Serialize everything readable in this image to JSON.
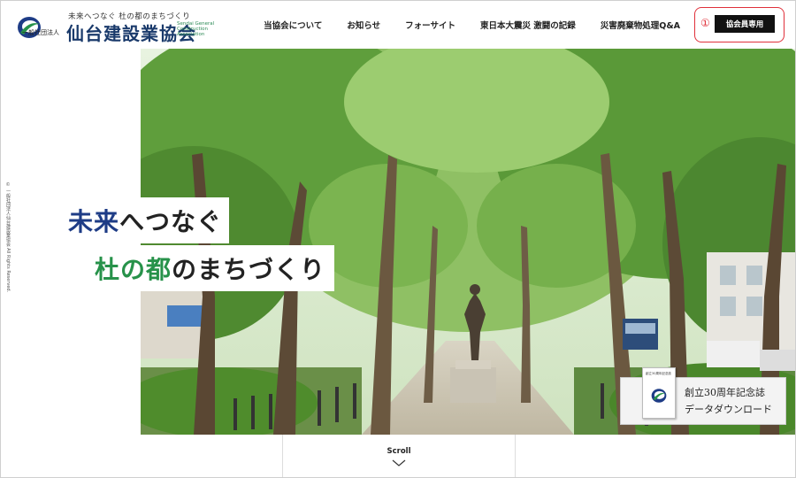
{
  "header": {
    "logo": {
      "tagline": "未来へつなぐ 杜の都のまちづくり",
      "org_type": "一般社団法人",
      "name": "仙台建設業協会",
      "english": "Sendai General Construction Association"
    },
    "nav": [
      {
        "label": "当協会について"
      },
      {
        "label": "お知らせ"
      },
      {
        "label": "フォーサイト"
      },
      {
        "label": "東日本大震災 激闘の記録"
      },
      {
        "label": "災害廃棄物処理Q&A"
      }
    ],
    "member_marker": "①",
    "member_button": "協会員専用"
  },
  "hero": {
    "catch_line1_highlight": "未来",
    "catch_line1_rest": "へつなぐ",
    "catch_line2_highlight": "杜の都",
    "catch_line2_rest": "のまちづくり"
  },
  "copyright": "© 一般社団法人仙台建設業協会 All Rights Reserved.",
  "banner": {
    "book_title": "創立30周年記念誌",
    "line1": "創立30周年記念誌",
    "line2": "データダウンロード"
  },
  "scroll": {
    "label": "Scroll"
  },
  "colors": {
    "accent_blue": "#1e3c86",
    "accent_green": "#27924a",
    "highlight_red": "#e0303a",
    "button_black": "#111111"
  }
}
